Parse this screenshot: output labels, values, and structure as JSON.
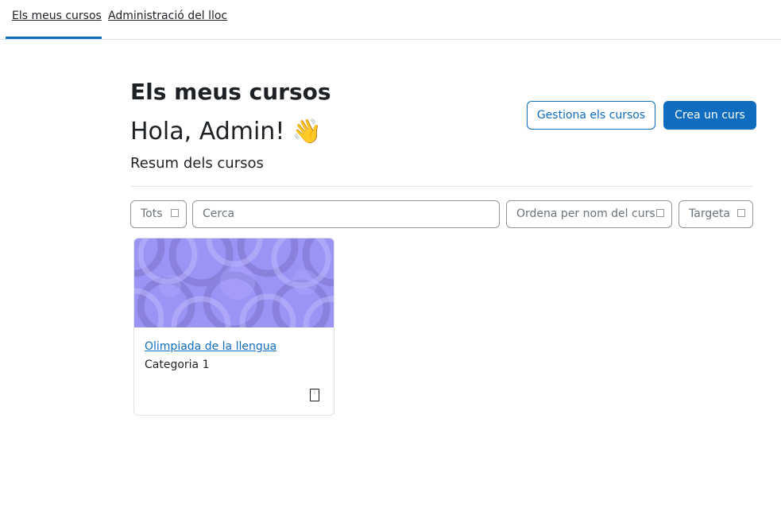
{
  "nav": {
    "tabs": [
      {
        "label": "Els meus cursos",
        "active": true
      },
      {
        "label": "Administració del lloc",
        "active": false
      }
    ]
  },
  "page": {
    "title": "Els meus cursos",
    "greeting": "Hola, Admin!",
    "greeting_emoji": "👋",
    "section": "Resum dels cursos"
  },
  "actions": {
    "manage_label": "Gestiona els cursos",
    "create_label": "Crea un curs"
  },
  "filters": {
    "grouping": "Tots",
    "search_placeholder": "Cerca",
    "sort": "Ordena per nom del curs",
    "view": "Targeta"
  },
  "courses": [
    {
      "name": "Olimpiada de la llengua",
      "category": "Categoria 1",
      "menu_glyph": "⋮"
    }
  ],
  "colors": {
    "accent": "#0f6cbf",
    "card_image": "#9c94f4"
  }
}
